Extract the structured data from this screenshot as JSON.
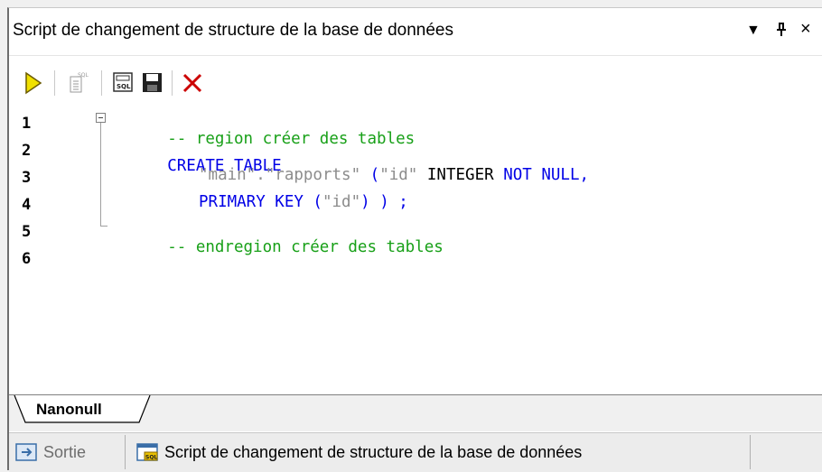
{
  "window": {
    "title": "Script de changement de structure de la base de données",
    "dropdown_glyph": "▼",
    "pin_glyph": "ᚠ",
    "close_glyph": "×"
  },
  "toolbar": {
    "buttons": [
      {
        "name": "run-icon"
      },
      {
        "name": "sql-script-icon"
      },
      {
        "name": "open-sql-editor-icon"
      },
      {
        "name": "save-icon"
      },
      {
        "name": "close-icon"
      }
    ]
  },
  "editor": {
    "line_numbers": [
      "1",
      "2",
      "3",
      "4",
      "5",
      "6"
    ],
    "lines": {
      "l1_comment": "-- region créer des tables",
      "l2_kw": "CREATE TABLE",
      "l3_str": "\"main\".\"rapports\"",
      "l3_paren": " (",
      "l3_id": "\"id\"",
      "l3_type": " INTEGER ",
      "l3_kw": "NOT NULL,",
      "l4_kw": "PRIMARY KEY (",
      "l4_id": "\"id\"",
      "l4_end": ") ) ;",
      "l5_comment": "-- endregion créer des tables"
    }
  },
  "tabs": {
    "active": "Nanonull"
  },
  "bottom_tabs": {
    "output": "Sortie",
    "script": "Script de changement de structure de la base de données"
  },
  "colors": {
    "comment": "#18a018",
    "keyword": "#0000e6",
    "string": "#8c8c8c",
    "run_icon": "#e8d800",
    "close_icon": "#cc0000"
  }
}
